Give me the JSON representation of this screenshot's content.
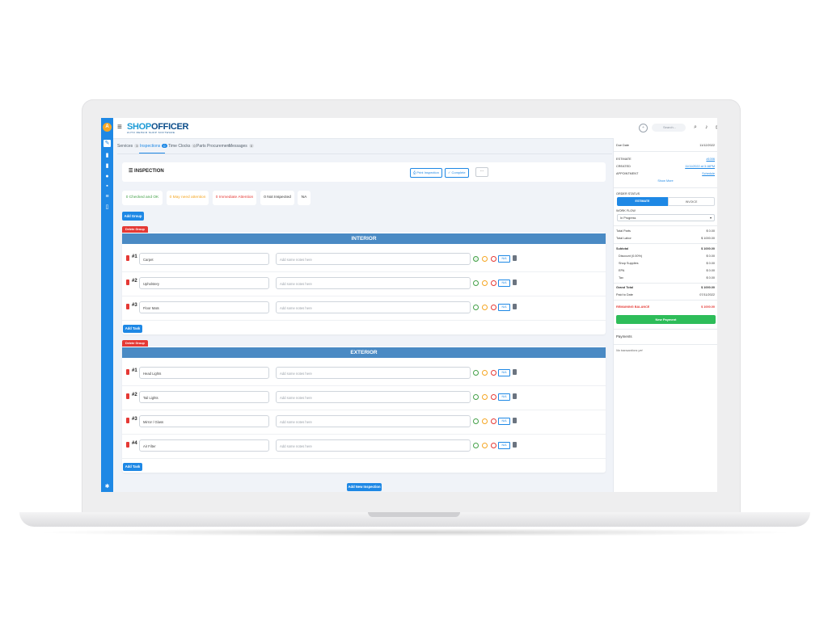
{
  "app": {
    "logo_main": "SHOP",
    "logo_accent": "OFFICER",
    "logo_tagline": "AUTO REPAIR SHOP SOFTWARE",
    "avatar_initial": "A",
    "search_placeholder": "Search..."
  },
  "tabs": [
    {
      "label": "Services",
      "count": "3"
    },
    {
      "label": "Inspections",
      "count": "0"
    },
    {
      "label": "Time Clocks",
      "count": "0"
    },
    {
      "label": "Parts Procurement",
      "count": ""
    },
    {
      "label": "Messages",
      "count": "0"
    }
  ],
  "inspection": {
    "title": "INSPECTION",
    "print_label": "Print Inspection",
    "complete_label": "Complete",
    "more_label": "···",
    "stats": [
      {
        "label": "0 Checked and OK",
        "color": "#43a047"
      },
      {
        "label": "0 May need attention",
        "color": "#f5a623"
      },
      {
        "label": "0 Immediate Attention",
        "color": "#e53935"
      },
      {
        "label": "0 Not Inspected",
        "color": "#333333"
      },
      {
        "label": "NA",
        "color": "#333333"
      }
    ],
    "add_group_label": "Add Group",
    "add_new_inspection_label": "Add New Inspection",
    "notes_placeholder": "Add some notes here",
    "na_label": "N/A",
    "groups": [
      {
        "delete_label": "Delete Group",
        "name": "INTERIOR",
        "add_task_label": "Add Task",
        "tasks": [
          {
            "num": "#1",
            "name": "Carpet"
          },
          {
            "num": "#2",
            "name": "Upholstery"
          },
          {
            "num": "#3",
            "name": "Floor Mats"
          }
        ]
      },
      {
        "delete_label": "Delete Group",
        "name": "EXTERIOR",
        "add_task_label": "Add Task",
        "tasks": [
          {
            "num": "#1",
            "name": "Head Lights"
          },
          {
            "num": "#2",
            "name": "Tail Lights"
          },
          {
            "num": "#3",
            "name": "Mirror / Glass"
          },
          {
            "num": "#4",
            "name": "Air Filter"
          }
        ]
      }
    ]
  },
  "right_panel": {
    "due_date_label": "Due Date",
    "due_date_value": "11/12/2022",
    "estimate_label": "ESTIMATE",
    "estimate_value": "#1006",
    "created_label": "CREATED",
    "created_value": "11/11/2022 at 3:16PM",
    "appointment_label": "APPOINTMENT",
    "appointment_value": "Schedule",
    "show_more": "Show More",
    "order_status_label": "ORDER STATUS",
    "status_estimate": "ESTIMATE",
    "status_invoice": "INVOICE",
    "workflow_label": "WORK FLOW",
    "workflow_value": "In Progress",
    "totals": [
      {
        "label": "Total Parts",
        "value": "$ 0.00"
      },
      {
        "label": "Total Labor",
        "value": "$ 1000.00"
      }
    ],
    "subtotal_label": "Subtotal",
    "subtotal_value": "$ 1000.00",
    "breakdown": [
      {
        "label": "Discount (0.00%)",
        "value": "$ 0.00"
      },
      {
        "label": "Shop Supplies",
        "value": "$ 0.00"
      },
      {
        "label": "EPA",
        "value": "$ 0.00"
      },
      {
        "label": "Tax",
        "value": "$ 0.00"
      }
    ],
    "grand_total_label": "Grand Total",
    "grand_total_value": "$ 1000.00",
    "paid_label": "Paid to Date",
    "paid_value": "07/11/2022",
    "remaining_label": "REMAINING BALANCE",
    "remaining_value": "$ 1000.00",
    "new_payment_label": "New Payment",
    "payments_label": "Payments",
    "no_transactions": "No transactions yet"
  },
  "colors": {
    "primary": "#1e88e5",
    "group_header": "#4a8ac4",
    "danger": "#e53935",
    "success": "#2ebd59"
  }
}
